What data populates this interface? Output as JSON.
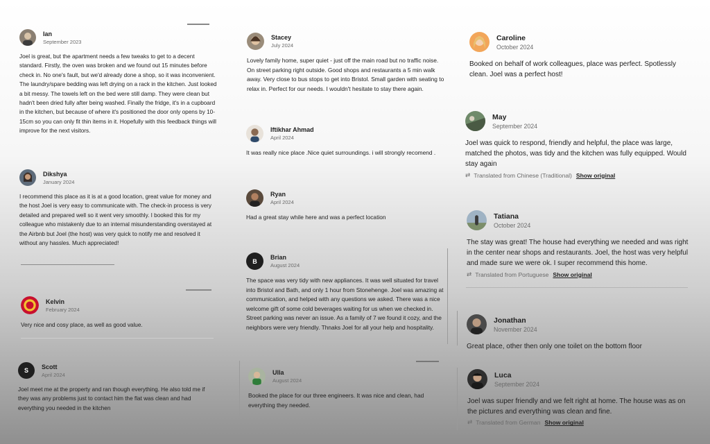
{
  "reviews": {
    "ian": {
      "name": "Ian",
      "date": "September 2023",
      "text": "Joel is great, but the apartment needs a few tweaks to get to a decent standard. Firstly, the oven was broken and we found out 15 minutes before check in. No one's fault, but we'd already done a shop, so it was inconvenient. The laundry/spare bedding was left drying on a rack in the kitchen. Just looked a bit messy. The towels left on the bed were still damp. They were clean but hadn't been dried fully after being washed. Finally the fridge, it's in a cupboard in the kitchen, but because of where it's positioned the door only opens by 10-15cm so you can only fit thin items in it. Hopefully with this feedback things will improve for the next visitors."
    },
    "dikshya": {
      "name": "Dikshya",
      "date": "January 2024",
      "text": "I recommend this place as it is at a good location, great value for money and the host Joel is very easy to communicate with. The check-in process is very detailed and prepared well so it went very smoothly. I booked this for my colleague who mistakenly due to an internal misunderstanding overstayed at the Airbnb but Joel (the host) was very quick to notify me and resolved it without any hassles. Much appreciated!"
    },
    "kelvin": {
      "name": "Kelvin",
      "date": "February 2024",
      "text": "Very nice and cosy place, as well as good value."
    },
    "scott": {
      "name": "Scott",
      "initial": "S",
      "date": "April 2024",
      "text": "Joel meet me at the property and ran though everything. He also told me if they was any problems just to contact him the flat was clean and had everything you needed in the kitchen"
    },
    "stacey": {
      "name": "Stacey",
      "date": "July 2024",
      "text": "Lovely family home, super quiet - just off the main road but no traffic noise. On street parking right outside. Good shops and restaurants a 5 min walk away. Very close to bus stops to get into Bristol. Small garden with seating to relax in. Perfect for our needs. I wouldn't hesitate to stay there again."
    },
    "iftikhar": {
      "name": "Iftikhar Ahmad",
      "date": "April 2024",
      "text": "It was really nice place .Nice quiet surroundings. i will strongly recomend ."
    },
    "ryan": {
      "name": "Ryan",
      "date": "April 2024",
      "text": "Had a great stay while here and was a perfect location"
    },
    "brian": {
      "name": "Brian",
      "initial": "B",
      "date": "August 2024",
      "text": "The space was very tidy with new appliances. It was well situated for travel into Bristol and Bath, and only 1 hour from Stonehenge. Joel was amazing at communication, and helped with any questions we asked. There was a nice welcome gift of some cold beverages waiting for us when we checked in. Street parking was never an issue. As a family of 7 we found it cozy, and the neighbors were very friendly. Thnaks Joel for all your help and hospitality."
    },
    "ulla": {
      "name": "Ulla",
      "date": "August 2024",
      "text": "Booked the place for our three engineers. It was nice and clean, had everything they needed."
    },
    "caroline": {
      "name": "Caroline",
      "date": "October 2024",
      "text": "Booked on behalf of work colleagues, place was perfect. Spotlessly clean. Joel was a perfect host!"
    },
    "may": {
      "name": "May",
      "date": "September 2024",
      "text": "Joel was quick to respond, friendly and helpful, the place was large, matched the photos, was tidy and the kitchen was fully equipped. Would stay again",
      "translated": "Translated from Chinese (Traditional)"
    },
    "tatiana": {
      "name": "Tatiana",
      "date": "October 2024",
      "text": "The stay was great! The house had everything we needed and was right in the center near shops and restaurants. Joel, the host was very helpful and made sure we were ok. I super recommend this home.",
      "translated": "Translated from Portuguese"
    },
    "jonathan": {
      "name": "Jonathan",
      "date": "November 2024",
      "text": "Great place, other then only one toilet on the bottom floor"
    },
    "luca": {
      "name": "Luca",
      "date": "September 2024",
      "text": "Joel was super friendly and we felt right at home. The house was as on the pictures and everything was clean and fine.",
      "translated": "Translated from German"
    }
  },
  "show_original_label": "Show original",
  "colors": {
    "kelvin_badge": "#c8102e",
    "dark_avatar": "#1f1f1f"
  }
}
